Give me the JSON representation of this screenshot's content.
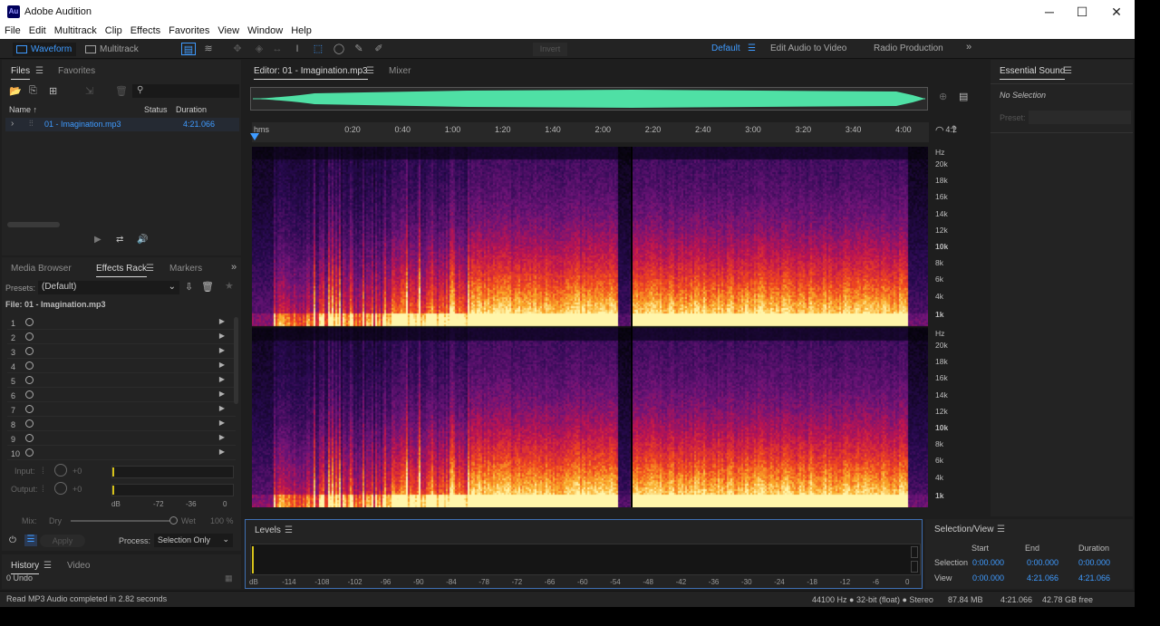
{
  "app": {
    "title": "Adobe Audition",
    "icon_label": "Au"
  },
  "window_controls": [
    "─",
    "☐",
    "✕"
  ],
  "menu": [
    "File",
    "Edit",
    "Multitrack",
    "Clip",
    "Effects",
    "Favorites",
    "View",
    "Window",
    "Help"
  ],
  "modes": {
    "waveform": "Waveform",
    "multitrack": "Multitrack"
  },
  "invert": "Invert",
  "workspaces": [
    "Default",
    "Edit Audio to Video",
    "Radio Production"
  ],
  "files_panel": {
    "tabs": [
      "Files",
      "Favorites"
    ],
    "columns": {
      "name": "Name",
      "status": "Status",
      "duration": "Duration"
    },
    "file": {
      "name": "01 - Imagination.mp3",
      "duration": "4:21.066"
    }
  },
  "effects_panel": {
    "tabs": [
      "Media Browser",
      "Effects Rack",
      "Markers"
    ],
    "presets_label": "Presets:",
    "preset_value": "(Default)",
    "file_label": "File: 01 - Imagination.mp3",
    "slots": [
      "1",
      "2",
      "3",
      "4",
      "5",
      "6",
      "7",
      "8",
      "9",
      "10"
    ],
    "input_label": "Input:",
    "output_label": "Output:",
    "gain_input": "+0",
    "gain_output": "+0",
    "meter_scale": [
      "dB",
      "-72",
      "-36",
      "0"
    ],
    "mix_label": "Mix:",
    "dry": "Dry",
    "wet": "Wet",
    "mix_percent": "100 %",
    "apply": "Apply",
    "process_label": "Process:",
    "process_value": "Selection Only"
  },
  "history_panel": {
    "tabs": [
      "History",
      "Video"
    ],
    "undo": "0 Undo"
  },
  "editor": {
    "tab": "Editor: 01 - Imagination.mp3",
    "mixer_tab": "Mixer",
    "time_unit": "hms",
    "time_ticks": [
      "0:20",
      "0:40",
      "1:00",
      "1:20",
      "1:40",
      "2:00",
      "2:20",
      "2:40",
      "3:00",
      "3:20",
      "3:40",
      "4:00",
      "4:2"
    ],
    "hz_unit": "Hz",
    "hz_labels": [
      "20k",
      "18k",
      "16k",
      "14k",
      "12k",
      "10k",
      "8k",
      "6k",
      "4k",
      "1k"
    ],
    "playhead_fraction": 0.56
  },
  "levels_panel": {
    "title": "Levels",
    "scale": [
      "dB",
      "-114",
      "-108",
      "-102",
      "-96",
      "-90",
      "-84",
      "-78",
      "-72",
      "-66",
      "-60",
      "-54",
      "-48",
      "-42",
      "-36",
      "-30",
      "-24",
      "-18",
      "-12",
      "-6",
      "0"
    ]
  },
  "essential_sound": {
    "title": "Essential Sound",
    "no_selection": "No Selection",
    "preset_label": "Preset:"
  },
  "selection_view": {
    "title": "Selection/View",
    "headers": [
      "Start",
      "End",
      "Duration"
    ],
    "selection_label": "Selection",
    "view_label": "View",
    "selection": [
      "0:00.000",
      "0:00.000",
      "0:00.000"
    ],
    "view": [
      "0:00.000",
      "4:21.066",
      "4:21.066"
    ]
  },
  "status": {
    "message": "Read MP3 Audio completed in 2.82 seconds",
    "format": "44100 Hz ● 32-bit (float) ● Stereo",
    "size": "87.84 MB",
    "duration": "4:21.066",
    "free": "42.78 GB free"
  },
  "colors": {
    "accent": "#3f9bff",
    "wave": "#4fe0a5",
    "bg": "#1e1e1e",
    "panel": "#232323"
  }
}
